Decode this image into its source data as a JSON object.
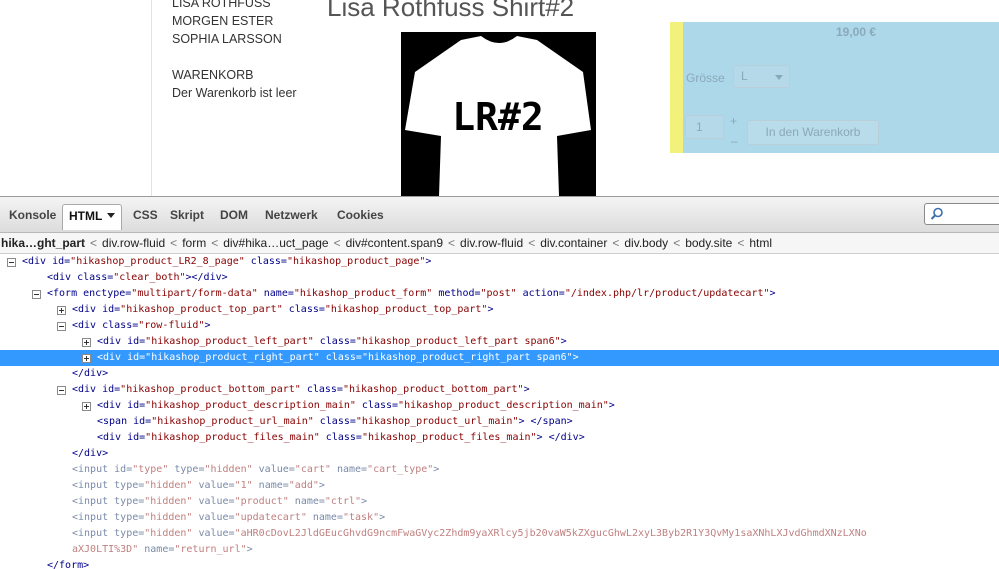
{
  "page": {
    "sidebar": {
      "names": [
        "LISA ROTHFUSS",
        "MORGEN ESTER",
        "SOPHIA LARSSON"
      ],
      "cart_heading": "WARENKORB",
      "cart_status": "Der Warenkorb ist leer"
    },
    "product": {
      "title": "Lisa Rothfuss Shirt#2",
      "image_text": "LR#2",
      "price": "19,00 €",
      "size_label": "Grösse",
      "size_value": "L",
      "quantity": "1",
      "plus": "+",
      "minus": "–",
      "add_to_cart": "In den Warenkorb"
    }
  },
  "devtools": {
    "tabs": [
      {
        "label": "Konsole"
      },
      {
        "label": "HTML",
        "active": true
      },
      {
        "label": "CSS"
      },
      {
        "label": "Skript"
      },
      {
        "label": "DOM"
      },
      {
        "label": "Netzwerk"
      },
      {
        "label": "Cookies"
      }
    ],
    "breadcrumb": [
      "hika…ght_part",
      "div.row-fluid",
      "form",
      "div#hika…uct_page",
      "div#content.span9",
      "div.row-fluid",
      "div.container",
      "div.body",
      "body.site",
      "html"
    ],
    "tree": [
      {
        "depth": 0,
        "expander": "minus",
        "parts": [
          [
            "tw",
            "<div "
          ],
          [
            "an",
            "id="
          ],
          [
            "av",
            "\"hikashop_product_LR2_8_page\""
          ],
          [
            "an",
            " class="
          ],
          [
            "av",
            "\"hikashop_product_page\""
          ],
          [
            "tw",
            ">"
          ]
        ]
      },
      {
        "depth": 1,
        "expander": "",
        "parts": [
          [
            "tw",
            "<div "
          ],
          [
            "an",
            "class="
          ],
          [
            "av",
            "\"clear_both\""
          ],
          [
            "tw",
            "></div>"
          ]
        ]
      },
      {
        "depth": 1,
        "expander": "minus",
        "parts": [
          [
            "tw",
            "<form "
          ],
          [
            "an",
            "enctype="
          ],
          [
            "av",
            "\"multipart/form-data\""
          ],
          [
            "an",
            " name="
          ],
          [
            "av",
            "\"hikashop_product_form\""
          ],
          [
            "an",
            " method="
          ],
          [
            "av",
            "\"post\""
          ],
          [
            "an",
            " action="
          ],
          [
            "av",
            "\"/index.php/lr/product/updatecart\""
          ],
          [
            "tw",
            ">"
          ]
        ]
      },
      {
        "depth": 2,
        "expander": "plus",
        "parts": [
          [
            "tw",
            "<div "
          ],
          [
            "an",
            "id="
          ],
          [
            "av",
            "\"hikashop_product_top_part\""
          ],
          [
            "an",
            " class="
          ],
          [
            "av",
            "\"hikashop_product_top_part\""
          ],
          [
            "tw",
            ">"
          ]
        ]
      },
      {
        "depth": 2,
        "expander": "minus",
        "parts": [
          [
            "tw",
            "<div "
          ],
          [
            "an",
            "class="
          ],
          [
            "av",
            "\"row-fluid\""
          ],
          [
            "tw",
            ">"
          ]
        ]
      },
      {
        "depth": 3,
        "expander": "plus",
        "parts": [
          [
            "tw",
            "<div "
          ],
          [
            "an",
            "id="
          ],
          [
            "av",
            "\"hikashop_product_left_part\""
          ],
          [
            "an",
            " class="
          ],
          [
            "av",
            "\"hikashop_product_left_part span6\""
          ],
          [
            "tw",
            ">"
          ]
        ]
      },
      {
        "depth": 3,
        "expander": "plus",
        "selected": true,
        "parts": [
          [
            "tw",
            "<div "
          ],
          [
            "an",
            "id="
          ],
          [
            "av",
            "\"hikashop_product_right_part\""
          ],
          [
            "an",
            " class="
          ],
          [
            "av",
            "\"hikashop_product_right_part span6\""
          ],
          [
            "tw",
            ">"
          ]
        ]
      },
      {
        "depth": 2,
        "expander": "",
        "parts": [
          [
            "tw",
            "</div>"
          ]
        ]
      },
      {
        "depth": 2,
        "expander": "minus",
        "parts": [
          [
            "tw",
            "<div "
          ],
          [
            "an",
            "id="
          ],
          [
            "av",
            "\"hikashop_product_bottom_part\""
          ],
          [
            "an",
            " class="
          ],
          [
            "av",
            "\"hikashop_product_bottom_part\""
          ],
          [
            "tw",
            ">"
          ]
        ]
      },
      {
        "depth": 3,
        "expander": "plus",
        "parts": [
          [
            "tw",
            "<div "
          ],
          [
            "an",
            "id="
          ],
          [
            "av",
            "\"hikashop_product_description_main\""
          ],
          [
            "an",
            " class="
          ],
          [
            "av",
            "\"hikashop_product_description_main\""
          ],
          [
            "tw",
            ">"
          ]
        ]
      },
      {
        "depth": 3,
        "expander": "",
        "parts": [
          [
            "tw",
            "<span "
          ],
          [
            "an",
            "id="
          ],
          [
            "av",
            "\"hikashop_product_url_main\""
          ],
          [
            "an",
            " class="
          ],
          [
            "av",
            "\"hikashop_product_url_main\""
          ],
          [
            "tw",
            ">  </span>"
          ]
        ]
      },
      {
        "depth": 3,
        "expander": "",
        "parts": [
          [
            "tw",
            "<div "
          ],
          [
            "an",
            "id="
          ],
          [
            "av",
            "\"hikashop_product_files_main\""
          ],
          [
            "an",
            " class="
          ],
          [
            "av",
            "\"hikashop_product_files_main\""
          ],
          [
            "tw",
            ">  </div>"
          ]
        ]
      },
      {
        "depth": 2,
        "expander": "",
        "parts": [
          [
            "tw",
            "</div>"
          ]
        ]
      },
      {
        "depth": 2,
        "expander": "",
        "hidden": true,
        "parts": [
          [
            "tw",
            "<input "
          ],
          [
            "an",
            "id="
          ],
          [
            "av",
            "\"type\""
          ],
          [
            "an",
            " type="
          ],
          [
            "av",
            "\"hidden\""
          ],
          [
            "an",
            " value="
          ],
          [
            "av",
            "\"cart\""
          ],
          [
            "an",
            " name="
          ],
          [
            "av",
            "\"cart_type\""
          ],
          [
            "tw",
            ">"
          ]
        ]
      },
      {
        "depth": 2,
        "expander": "",
        "hidden": true,
        "parts": [
          [
            "tw",
            "<input "
          ],
          [
            "an",
            "type="
          ],
          [
            "av",
            "\"hidden\""
          ],
          [
            "an",
            " value="
          ],
          [
            "av",
            "\"1\""
          ],
          [
            "an",
            " name="
          ],
          [
            "av",
            "\"add\""
          ],
          [
            "tw",
            ">"
          ]
        ]
      },
      {
        "depth": 2,
        "expander": "",
        "hidden": true,
        "parts": [
          [
            "tw",
            "<input "
          ],
          [
            "an",
            "type="
          ],
          [
            "av",
            "\"hidden\""
          ],
          [
            "an",
            " value="
          ],
          [
            "av",
            "\"product\""
          ],
          [
            "an",
            " name="
          ],
          [
            "av",
            "\"ctrl\""
          ],
          [
            "tw",
            ">"
          ]
        ]
      },
      {
        "depth": 2,
        "expander": "",
        "hidden": true,
        "parts": [
          [
            "tw",
            "<input "
          ],
          [
            "an",
            "type="
          ],
          [
            "av",
            "\"hidden\""
          ],
          [
            "an",
            " value="
          ],
          [
            "av",
            "\"updatecart\""
          ],
          [
            "an",
            " name="
          ],
          [
            "av",
            "\"task\""
          ],
          [
            "tw",
            ">"
          ]
        ]
      },
      {
        "depth": 2,
        "expander": "",
        "hidden": true,
        "parts": [
          [
            "tw",
            "<input "
          ],
          [
            "an",
            "type="
          ],
          [
            "av",
            "\"hidden\""
          ],
          [
            "an",
            " value="
          ],
          [
            "av",
            "\"aHR0cDovL2JldGEucGhvdG9ncmFwaGVyc2Zhdm9yaXRlcy5jb20vaW5kZXgucGhwL2xyL3Byb2R1Y3QvMy1saXNhLXJvdGhmdXNzLXNo"
          ]
        ]
      },
      {
        "depth": 2,
        "expander": "",
        "hidden": true,
        "parts": [
          [
            "av",
            "aXJ0LTI%3D\""
          ],
          [
            "an",
            " name="
          ],
          [
            "av",
            "\"return_url\""
          ],
          [
            "tw",
            ">"
          ]
        ]
      },
      {
        "depth": 1,
        "expander": "",
        "parts": [
          [
            "tw",
            "</form>"
          ]
        ]
      }
    ]
  },
  "colors": {
    "selection": "#3399ff",
    "tag": "#000088",
    "attr_value": "#880000",
    "right_part_bg": "#add8ea",
    "right_part_bar": "#f1f17c"
  },
  "icons": {
    "search": "search-icon",
    "dropdown": "chevron-down-icon"
  }
}
